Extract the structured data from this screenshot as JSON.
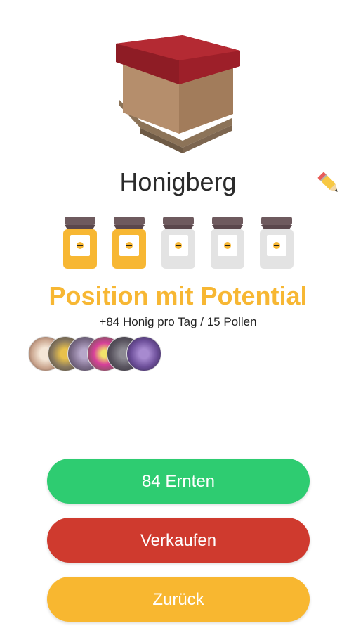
{
  "hive": {
    "name": "Honigberg"
  },
  "jars": {
    "filled": 2,
    "total": 5,
    "filled_color": "#f7b733",
    "empty_color": "#e3e3e3"
  },
  "status": {
    "title": "Position mit Potential",
    "subtitle": "+84 Honig pro Tag / 15 Pollen"
  },
  "flowers": [
    "wild-rose",
    "dandelion",
    "lavender",
    "pink-cistus",
    "heather",
    "purple-lavender"
  ],
  "buttons": {
    "harvest": "84 Ernten",
    "sell": "Verkaufen",
    "back": "Zurück"
  },
  "colors": {
    "green": "#2ecc71",
    "red": "#cf3a2e",
    "yellow": "#f8b730"
  }
}
